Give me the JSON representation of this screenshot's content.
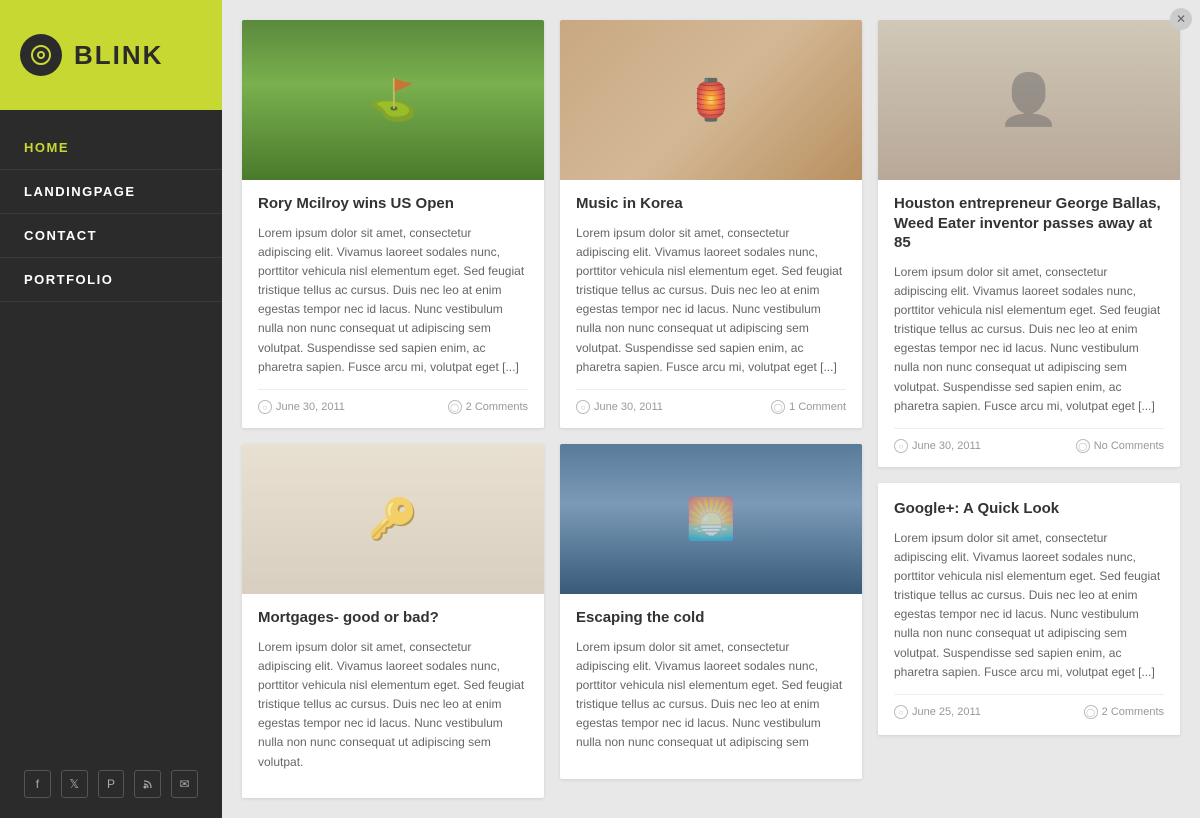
{
  "logo": {
    "title": "BLINK"
  },
  "nav": {
    "items": [
      {
        "label": "HOME",
        "active": true
      },
      {
        "label": "LANDINGPAGE",
        "active": false
      },
      {
        "label": "CONTACT",
        "active": false
      },
      {
        "label": "PORTFOLIO",
        "active": false
      }
    ]
  },
  "social": {
    "items": [
      "f",
      "t",
      "p",
      "rss",
      "mail"
    ]
  },
  "posts": {
    "col1": [
      {
        "id": "post-golf",
        "title": "Rory Mcilroy wins US Open",
        "excerpt": "Lorem ipsum dolor sit amet, consectetur adipiscing elit. Vivamus laoreet sodales nunc, porttitor vehicula nisl elementum eget. Sed feugiat tristique tellus ac cursus. Duis nec leo at enim egestas tempor nec id lacus. Nunc vestibulum nulla non nunc consequat ut adipiscing sem volutpat. Suspendisse sed sapien enim, ac pharetra sapien. Fusce arcu mi, volutpat eget [...]",
        "date": "June 30, 2011",
        "comments": "2 Comments",
        "img_type": "golf"
      },
      {
        "id": "post-mortgage",
        "title": "Mortgages- good or bad?",
        "excerpt": "Lorem ipsum dolor sit amet, consectetur adipiscing elit. Vivamus laoreet sodales nunc, porttitor vehicula nisl elementum eget. Sed feugiat tristique tellus ac cursus. Duis nec leo at enim egestas tempor nec id lacus. Nunc vestibulum nulla non nunc consequat ut adipiscing sem volutpat.",
        "date": "",
        "comments": "",
        "img_type": "mortgage"
      }
    ],
    "col2": [
      {
        "id": "post-korea",
        "title": "Music in Korea",
        "excerpt": "Lorem ipsum dolor sit amet, consectetur adipiscing elit. Vivamus laoreet sodales nunc, porttitor vehicula nisl elementum eget. Sed feugiat tristique tellus ac cursus. Duis nec leo at enim egestas tempor nec id lacus. Nunc vestibulum nulla non nunc consequat ut adipiscing sem volutpat. Suspendisse sed sapien enim, ac pharetra sapien. Fusce arcu mi, volutpat eget [...]",
        "date": "June 30, 2011",
        "comments": "1 Comment",
        "img_type": "korea"
      },
      {
        "id": "post-cold",
        "title": "Escaping the cold",
        "excerpt": "Lorem ipsum dolor sit amet, consectetur adipiscing elit. Vivamus laoreet sodales nunc, porttitor vehicula nisl elementum eget. Sed feugiat tristique tellus ac cursus. Duis nec leo at enim egestas tempor nec id lacus. Nunc vestibulum nulla non nunc consequat ut adipiscing sem",
        "date": "",
        "comments": "",
        "img_type": "cold"
      }
    ],
    "col3": [
      {
        "id": "post-george",
        "title": "Houston entrepreneur George Ballas, Weed Eater inventor passes away at 85",
        "excerpt": "Lorem ipsum dolor sit amet, consectetur adipiscing elit. Vivamus laoreet sodales nunc, porttitor vehicula nisl elementum eget. Sed feugiat tristique tellus ac cursus. Duis nec leo at enim egestas tempor nec id lacus. Nunc vestibulum nulla non nunc consequat ut adipiscing sem volutpat. Suspendisse sed sapien enim, ac pharetra sapien. Fusce arcu mi, volutpat eget [...]",
        "date": "June 30, 2011",
        "comments": "No Comments",
        "img_type": "portrait"
      },
      {
        "id": "post-google",
        "title": "Google+: A Quick Look",
        "excerpt": "Lorem ipsum dolor sit amet, consectetur adipiscing elit. Vivamus laoreet sodales nunc, porttitor vehicula nisl elementum eget. Sed feugiat tristique tellus ac cursus. Duis nec leo at enim egestas tempor nec id lacus. Nunc vestibulum nulla non nunc consequat ut adipiscing sem volutpat. Suspendisse sed sapien enim, ac pharetra sapien. Fusce arcu mi, volutpat eget [...]",
        "date": "June 25, 2011",
        "comments": "2 Comments",
        "img_type": "none"
      }
    ]
  }
}
